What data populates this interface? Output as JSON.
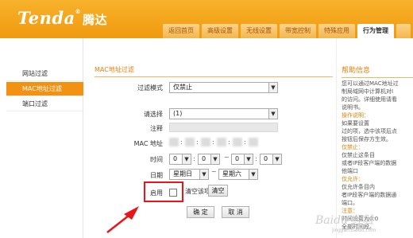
{
  "header": {
    "logo_text": "Tenda",
    "logo_reg": "®",
    "logo_cn": "腾达",
    "tabs": [
      {
        "label": "返回首页"
      },
      {
        "label": "高级设置"
      },
      {
        "label": "无线设置"
      },
      {
        "label": "带宽控制"
      },
      {
        "label": "特殊应用"
      },
      {
        "label": "行为管理"
      },
      {
        "label": ""
      }
    ],
    "active_tab_index": 5
  },
  "sidebar": {
    "items": [
      {
        "label": "网站过滤"
      },
      {
        "label": "MAC地址过滤"
      },
      {
        "label": "端口过滤"
      }
    ],
    "active_index": 1
  },
  "main": {
    "title": "MAC地址过滤",
    "filter_mode": {
      "label": "过滤模式",
      "value": "仅禁止"
    },
    "choose": {
      "label": "请选择",
      "value": "(1)"
    },
    "note": {
      "label": "注释"
    },
    "mac": {
      "label": "MAC 地址",
      "separators": [
        ":",
        ":",
        ":",
        ":",
        ":"
      ]
    },
    "time": {
      "label": "时间",
      "h1": "0",
      "m1": "0",
      "tilde": "~",
      "h2": "0",
      "m2": "0"
    },
    "date": {
      "label": "日期",
      "from": "星期日",
      "tilde": "~",
      "to": "星期六"
    },
    "enable": {
      "label": "启用",
      "checked": false
    },
    "clear_label": "清空该项:",
    "clear_button": "清空",
    "ok_button": "确 定",
    "cancel_button": "取 消"
  },
  "help": {
    "title": "帮助信息",
    "lines": [
      {
        "text": "您可以通过MAC地址过",
        "hl": ""
      },
      {
        "text": "制局域网中计算机对I",
        "hl": ""
      },
      {
        "text": "的访问。详细使用请看",
        "hl": ""
      },
      {
        "text": "说明书。",
        "hl": ""
      },
      {
        "text": "",
        "hl": "操作说明："
      },
      {
        "text": "如果要设置",
        "hl": ""
      },
      {
        "text": "过的项，选中该项后点",
        "hl": ""
      },
      {
        "text": "按钮后保存方生效。",
        "hl": ""
      },
      {
        "text": "",
        "hl": "仅禁止："
      },
      {
        "text": "仅禁止这条目",
        "hl": ""
      },
      {
        "text": "或者IP段客户端的数据",
        "hl": ""
      },
      {
        "text": "他端口",
        "hl": ""
      },
      {
        "text": "",
        "hl": "仅允许："
      },
      {
        "text": "仅允许条目内",
        "hl": ""
      },
      {
        "text": "者IP段客户端的数据通",
        "hl": ""
      },
      {
        "text": "端口。",
        "hl": ""
      },
      {
        "text": "",
        "hl": "注意："
      },
      {
        "text": "时间设置为0:0",
        "hl": ""
      },
      {
        "text": "全部时间段。",
        "hl": ""
      }
    ]
  },
  "watermark": {
    "text": "Baidu 经验",
    "sub": "jingyan.baidu.com"
  },
  "colors": {
    "accent": "#f39212",
    "header": "#f09a0f",
    "highlight_box": "#e8151b",
    "arrow": "#e8151b"
  }
}
